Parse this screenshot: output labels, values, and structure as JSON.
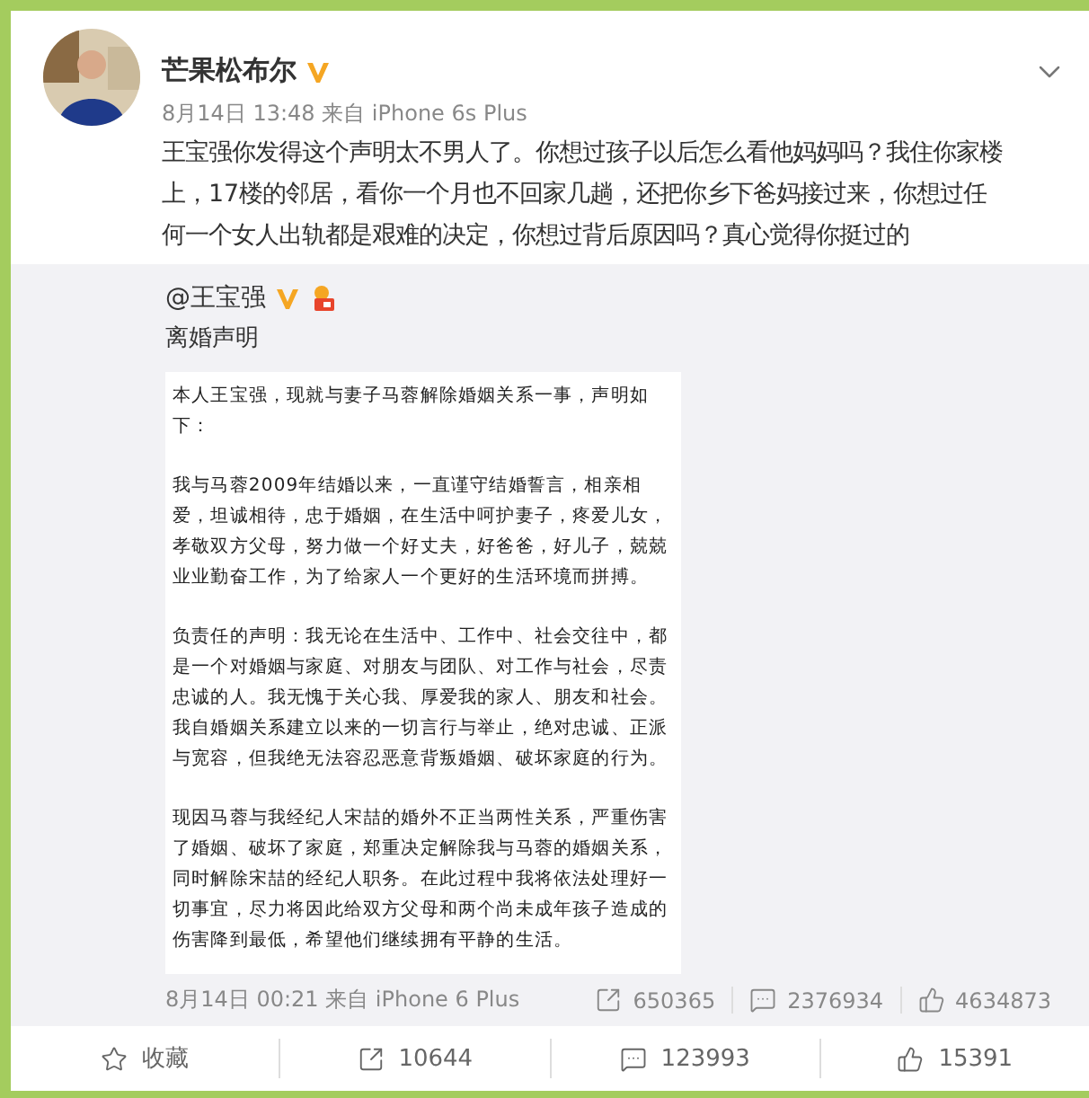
{
  "post": {
    "author": "芒果松布尔",
    "verified": true,
    "meta": "8月14日 13:48 来自 iPhone 6s Plus",
    "body": "王宝强你发得这个声明太不男人了。你想过孩子以后怎么看他妈妈吗？我住你家楼上，17楼的邻居，看你一个月也不回家几趟，还把你乡下爸妈接过来，你想过任何一个女人出轨都是艰难的决定，你想过背后原因吗？真心觉得你挺过的"
  },
  "repost": {
    "author": "@王宝强",
    "verified": true,
    "member_badge": true,
    "title": "离婚声明",
    "document": [
      "本人王宝强，现就与妻子马蓉解除婚姻关系一事，声明如下：",
      "我与马蓉2009年结婚以来，一直谨守结婚誓言，相亲相爱，坦诚相待，忠于婚姻，在生活中呵护妻子，疼爱儿女，孝敬双方父母，努力做一个好丈夫，好爸爸，好儿子，兢兢业业勤奋工作，为了给家人一个更好的生活环境而拼搏。",
      "负责任的声明：我无论在生活中、工作中、社会交往中，都是一个对婚姻与家庭、对朋友与团队、对工作与社会，尽责忠诚的人。我无愧于关心我、厚爱我的家人、朋友和社会。我自婚姻关系建立以来的一切言行与举止，绝对忠诚、正派与宽容，但我绝无法容忍恶意背叛婚姻、破坏家庭的行为。",
      "现因马蓉与我经纪人宋喆的婚外不正当两性关系，严重伤害了婚姻、破坏了家庭，郑重决定解除我与马蓉的婚姻关系，同时解除宋喆的经纪人职务。在此过程中我将依法处理好一切事宜，尽力将因此给双方父母和两个尚未成年孩子造成的伤害降到最低，希望他们继续拥有平静的生活。"
    ],
    "meta": "8月14日 00:21 来自 iPhone 6 Plus",
    "stats": [
      {
        "kind": "repost",
        "count": "650365"
      },
      {
        "kind": "comment",
        "count": "2376934"
      },
      {
        "kind": "like",
        "count": "4634873"
      }
    ]
  },
  "actions": [
    {
      "kind": "favorite",
      "label": "收藏"
    },
    {
      "kind": "repost",
      "label": "10644"
    },
    {
      "kind": "comment",
      "label": "123993"
    },
    {
      "kind": "like",
      "label": "15391"
    }
  ]
}
